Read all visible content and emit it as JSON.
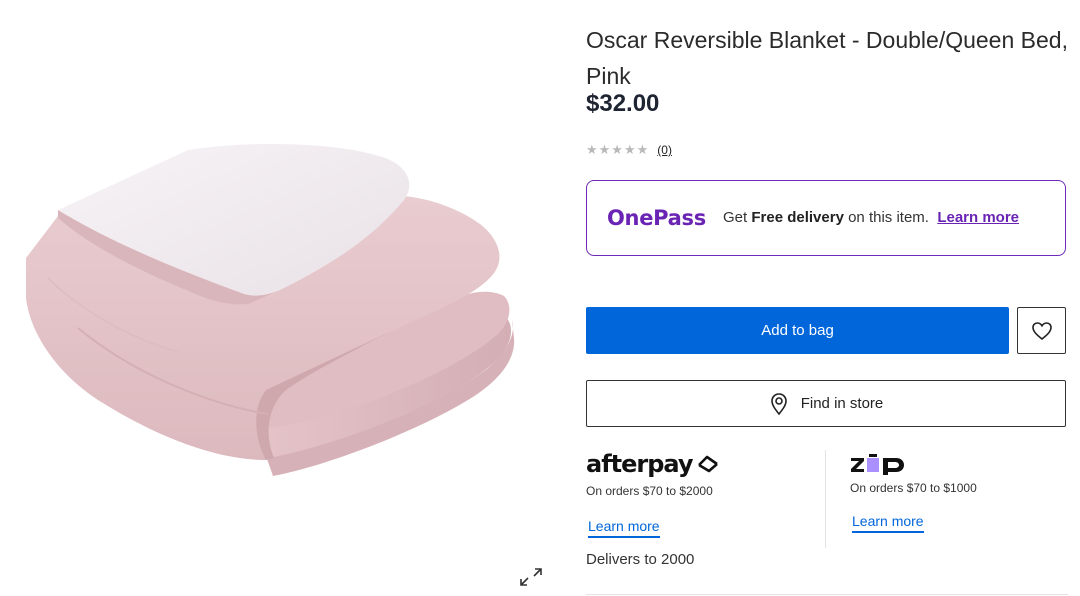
{
  "product": {
    "title": "Oscar Reversible Blanket - Double/Queen Bed, Pink",
    "price": "$32.00",
    "rating": {
      "stars": "★★★★★",
      "value": 0,
      "max": 5,
      "review_count": "(0)"
    }
  },
  "gallery": {
    "image_icon": "folded-blanket",
    "expand_icon": "expand-arrows-icon"
  },
  "onepass": {
    "logo": "OnePass",
    "text_prefix": "Get ",
    "text_bold": "Free delivery",
    "text_suffix": " on this item.",
    "link": "Learn more"
  },
  "actions": {
    "add_to_bag": "Add to bag",
    "wishlist_icon": "heart-icon",
    "find_in_store": "Find in store",
    "find_icon": "location-pin-icon"
  },
  "afterpay": {
    "logo": "afterpay",
    "range": "On orders $70 to $2000",
    "link": "Learn more"
  },
  "zip": {
    "logo": "zip",
    "range": "On orders $70 to $1000",
    "link": "Learn more"
  },
  "delivery": {
    "text": "Delivers to 2000"
  },
  "colors": {
    "primary": "#0066d9",
    "onepass": "#6a24b4",
    "blanket": "#e6c5c9",
    "fleece": "#f2eef1",
    "zip_purple": "#aa8fff"
  }
}
